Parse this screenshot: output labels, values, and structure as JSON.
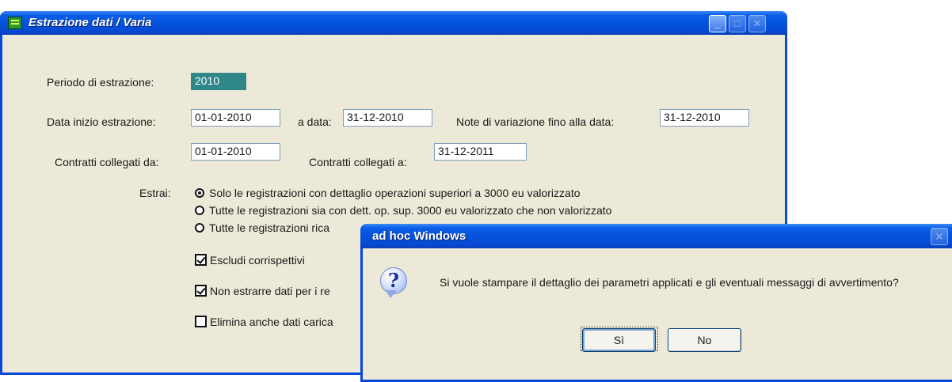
{
  "main_window": {
    "title": "Estrazione dati / Varia",
    "periodo_label": "Periodo di estrazione:",
    "periodo_value": "2010",
    "data_inizio_label": "Data inizio estrazione:",
    "data_inizio_value": "01-01-2010",
    "a_data_label": "a data:",
    "a_data_value": "31-12-2010",
    "note_label": "Note di variazione fino alla data:",
    "note_value": "31-12-2010",
    "contratti_da_label": "Contratti collegati da:",
    "contratti_da_value": "01-01-2010",
    "contratti_a_label": "Contratti collegati a:",
    "contratti_a_value": "31-12-2011",
    "estrai_label": "Estrai:",
    "estrai_options": [
      {
        "label": "Solo le registrazioni con dettaglio operazioni superiori a 3000 eu valorizzato",
        "selected": true
      },
      {
        "label": "Tutte le registrazioni sia con dett. op. sup. 3000 eu valorizzato che non valorizzato",
        "selected": false
      },
      {
        "label": "Tutte le registrazioni rica",
        "selected": false
      }
    ],
    "checkboxes": [
      {
        "label": "Escludi corrispettivi",
        "checked": true
      },
      {
        "label": "Non estrarre dati per i re",
        "checked": true
      },
      {
        "label": "Elimina anche dati carica",
        "checked": false
      }
    ]
  },
  "dialog": {
    "title": "ad hoc Windows",
    "message": "Si vuole stampare il dettaglio dei parametri applicati e gli eventuali messaggi di avvertimento?",
    "yes_label": "Sì",
    "no_label": "No"
  }
}
